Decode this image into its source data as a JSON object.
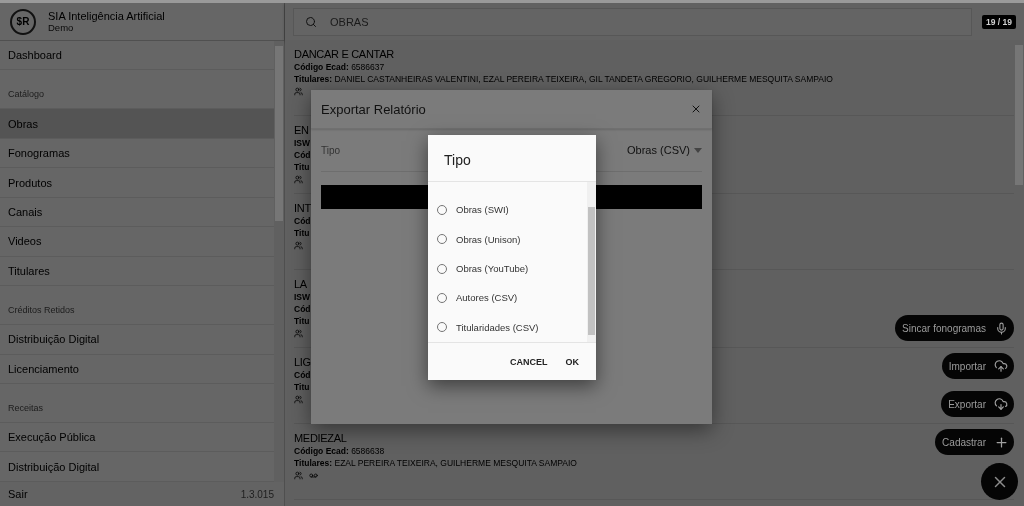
{
  "header": {
    "logo_text": "$R",
    "title": "SIA Inteligência Artificial",
    "subtitle": "Demo"
  },
  "search": {
    "placeholder": "OBRAS"
  },
  "counter": "19 / 19",
  "sidebar": {
    "items": [
      {
        "kind": "item",
        "label": "Dashboard",
        "selected": false
      },
      {
        "kind": "section",
        "label": "Catálogo"
      },
      {
        "kind": "item",
        "label": "Obras",
        "selected": true
      },
      {
        "kind": "item",
        "label": "Fonogramas",
        "selected": false
      },
      {
        "kind": "item",
        "label": "Produtos",
        "selected": false
      },
      {
        "kind": "item",
        "label": "Canais",
        "selected": false
      },
      {
        "kind": "item",
        "label": "Videos",
        "selected": false
      },
      {
        "kind": "item",
        "label": "Titulares",
        "selected": false
      },
      {
        "kind": "section",
        "label": "Créditos Retidos"
      },
      {
        "kind": "item",
        "label": "Distribuição Digital",
        "selected": false
      },
      {
        "kind": "item",
        "label": "Licenciamento",
        "selected": false
      },
      {
        "kind": "section",
        "label": "Receitas"
      },
      {
        "kind": "item",
        "label": "Execução Pública",
        "selected": false
      },
      {
        "kind": "item",
        "label": "Distribuição Digital",
        "selected": false
      }
    ],
    "footer": {
      "label": "Sair",
      "version": "1.3.015"
    }
  },
  "works": [
    {
      "title": "DANCAR E CANTAR",
      "lines": [
        "**Código Ecad:** 6586637",
        "**Titulares:** DANIEL CASTANHEIRAS VALENTINI, EZAL PEREIRA TEIXEIRA, GIL TANDETA GREGORIO, GUILHERME MESQUITA SAMPAIO"
      ],
      "kind": "plain"
    },
    {
      "title": "EN",
      "lines": [
        "**ISW**",
        "**Cód**",
        "**Titu**"
      ],
      "kind": "plain"
    },
    {
      "title": "INT",
      "lines": [
        "**Cód**",
        "**Titu**"
      ],
      "kind": "plain"
    },
    {
      "title": "LA",
      "lines": [
        "**ISW**",
        "**Cód**",
        "**Titu**"
      ],
      "kind": "plain"
    },
    {
      "title": "LIG",
      "lines": [
        "**Cód**",
        "**Titu**"
      ],
      "kind": "plain"
    },
    {
      "title": "MEDIEZAL",
      "lines": [
        "**Código Ecad:** 6586638",
        "**Titulares:** EZAL PEREIRA TEIXEIRA, GUILHERME MESQUITA SAMPAIO"
      ],
      "kind": "recorded"
    }
  ],
  "export_dialog": {
    "title": "Exportar Relatório",
    "field": {
      "label": "Tipo",
      "value": "Obras (CSV)"
    }
  },
  "picker": {
    "title": "Tipo",
    "options": [
      {
        "label": "Obras (SWI)",
        "selected": false
      },
      {
        "label": "Obras (Unison)",
        "selected": false
      },
      {
        "label": "Obras (YouTube)",
        "selected": false
      },
      {
        "label": "Autores (CSV)",
        "selected": false
      },
      {
        "label": "Titularidades (CSV)",
        "selected": false
      }
    ],
    "buttons": [
      "CANCEL",
      "OK"
    ]
  },
  "fabs": [
    {
      "label": "Sincar fonogramas"
    },
    {
      "label": "Importar"
    },
    {
      "label": "Exportar"
    },
    {
      "label": "Cadastrar"
    }
  ]
}
